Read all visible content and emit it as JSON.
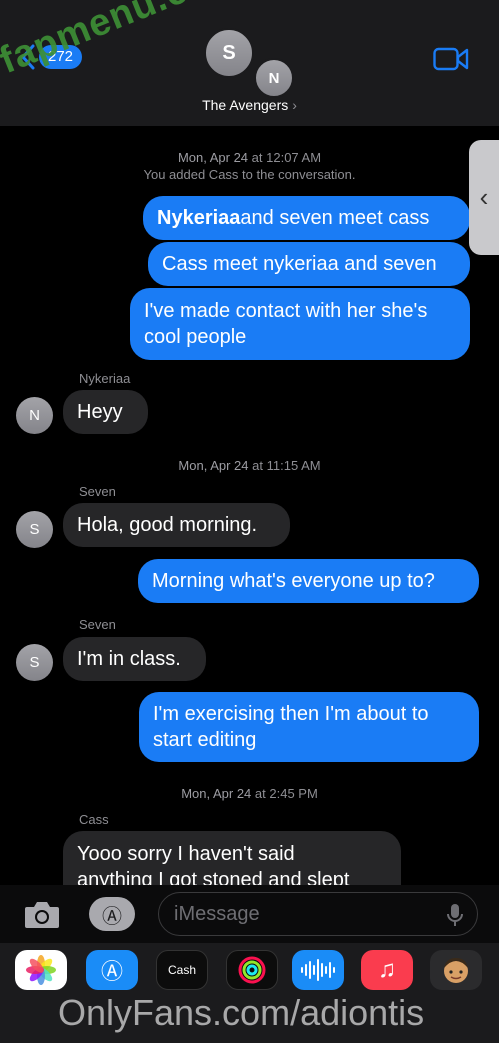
{
  "header": {
    "back_count": "272",
    "avatars": [
      "S",
      "N"
    ],
    "group_name": "The Avengers",
    "accent": "#1a7cf5"
  },
  "watermarks": {
    "top": "fapmenu.com",
    "bottom": "OnlyFans.com/adiontis"
  },
  "messages": {
    "ts1_date": "Mon, Apr 24",
    "ts1_time": "12:07 AM",
    "system_note": "You added Cass to the conversation.",
    "m1_bold": "Nykeriaa",
    "m1_rest": " and seven meet cass",
    "m2": "Cass meet nykeriaa and seven",
    "m3_line1": "I've made contact with her she's",
    "m3_line2": "cool people",
    "sender1": "Nykeriaa",
    "avatar1": "N",
    "m4": "Heyy",
    "ts2_date": "Mon, Apr 24",
    "ts2_time": "11:15 AM",
    "sender2": "Seven",
    "avatar2": "S",
    "m5": "Hola, good morning.",
    "m6": "Morning what's everyone up to?",
    "sender3": "Seven",
    "avatar3": "S",
    "m7": "I'm in class.",
    "m8_line1": "I'm exercising then I'm about to",
    "m8_line2": "start editing",
    "ts3_date": "Mon, Apr 24",
    "ts3_time": "2:45 PM",
    "sender4": "Cass",
    "m9_line1": "Yooo sorry I haven't said",
    "m9_line2": "anything I got stoned and slept"
  },
  "input": {
    "placeholder": "iMessage"
  },
  "drawer": {
    "cash_label": "Cash",
    "app_icons": [
      "photos-icon",
      "app-store-icon",
      "apple-cash-icon",
      "activity-icon",
      "audio-message-icon",
      "music-icon",
      "memoji-icon"
    ]
  }
}
